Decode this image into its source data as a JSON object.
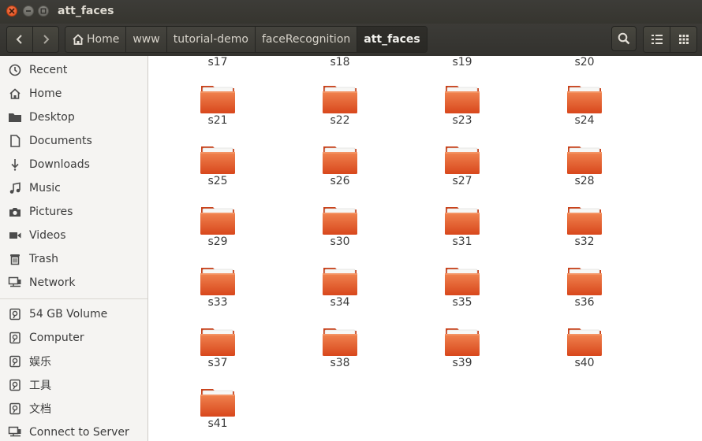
{
  "window": {
    "title": "att_faces"
  },
  "breadcrumbs": [
    {
      "label": "Home"
    },
    {
      "label": "www"
    },
    {
      "label": "tutorial-demo"
    },
    {
      "label": "faceRecognition"
    },
    {
      "label": "att_faces"
    }
  ],
  "sidebar": {
    "places": [
      {
        "label": "Recent",
        "icon": "clock-icon"
      },
      {
        "label": "Home",
        "icon": "home-icon"
      },
      {
        "label": "Desktop",
        "icon": "folder-icon"
      },
      {
        "label": "Documents",
        "icon": "document-icon"
      },
      {
        "label": "Downloads",
        "icon": "download-icon"
      },
      {
        "label": "Music",
        "icon": "music-icon"
      },
      {
        "label": "Pictures",
        "icon": "camera-icon"
      },
      {
        "label": "Videos",
        "icon": "video-icon"
      },
      {
        "label": "Trash",
        "icon": "trash-icon"
      },
      {
        "label": "Network",
        "icon": "network-icon"
      }
    ],
    "devices": [
      {
        "label": "54 GB Volume",
        "icon": "drive-icon"
      },
      {
        "label": "Computer",
        "icon": "drive-icon"
      },
      {
        "label": "娱乐",
        "icon": "drive-icon"
      },
      {
        "label": "工具",
        "icon": "drive-icon"
      },
      {
        "label": "文档",
        "icon": "drive-icon"
      },
      {
        "label": "Connect to Server",
        "icon": "server-icon"
      }
    ]
  },
  "files": {
    "partial_row": [
      "s17",
      "s18",
      "s19",
      "s20"
    ],
    "folders": [
      "s21",
      "s22",
      "s23",
      "s24",
      "s25",
      "s26",
      "s27",
      "s28",
      "s29",
      "s30",
      "s31",
      "s32",
      "s33",
      "s34",
      "s35",
      "s36",
      "s37",
      "s38",
      "s39",
      "s40",
      "s41"
    ]
  },
  "colors": {
    "folder": "#e8582a",
    "accent": "#df4a16"
  }
}
